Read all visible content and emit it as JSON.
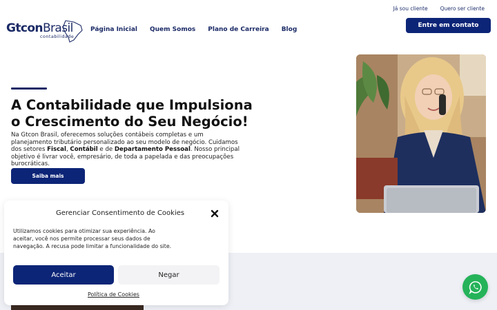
{
  "utility_links": [
    "Já sou cliente",
    "Quero ser cliente"
  ],
  "logo": {
    "brand_main": "Gtcon",
    "brand_rest": "Brasil",
    "subtitle": "contabilidade"
  },
  "nav": [
    "Página Inicial",
    "Quem Somos",
    "Plano de Carreira",
    "Blog"
  ],
  "header_cta": "Entre em contato",
  "hero": {
    "title": "A Contabilidade que Impulsiona o Crescimento do Seu Negócio!",
    "text_part1": "Na Gtcon Brasil, oferecemos soluções contábeis completas e um planejamento tributário personalizado ao seu modelo de negócio. Cuidamos dos setores ",
    "bold1": "Fiscal",
    "sep1": ", ",
    "bold2": "Contábil",
    "sep2": " e de ",
    "bold3": "Departamento Pessoal",
    "text_part2": ". Nosso principal objetivo é livrar você, empresário, de toda a papelada e das preocupações burocráticas.",
    "button": "Saiba mais"
  },
  "cookie_dialog": {
    "title": "Gerenciar Consentimento de Cookies",
    "body": "Utilizamos cookies para otimizar sua experiência. Ao aceitar, você nos permite processar seus dados de navegação. A recusa pode limitar a funcionalidade do site.",
    "accept": "Aceitar",
    "deny": "Negar",
    "policy": "Política de Cookies"
  },
  "icons": {
    "close": "close-icon",
    "whatsapp": "whatsapp-icon"
  },
  "colors": {
    "primary": "#0d2577",
    "whatsapp": "#25b35a",
    "band": "#eef0f6"
  }
}
